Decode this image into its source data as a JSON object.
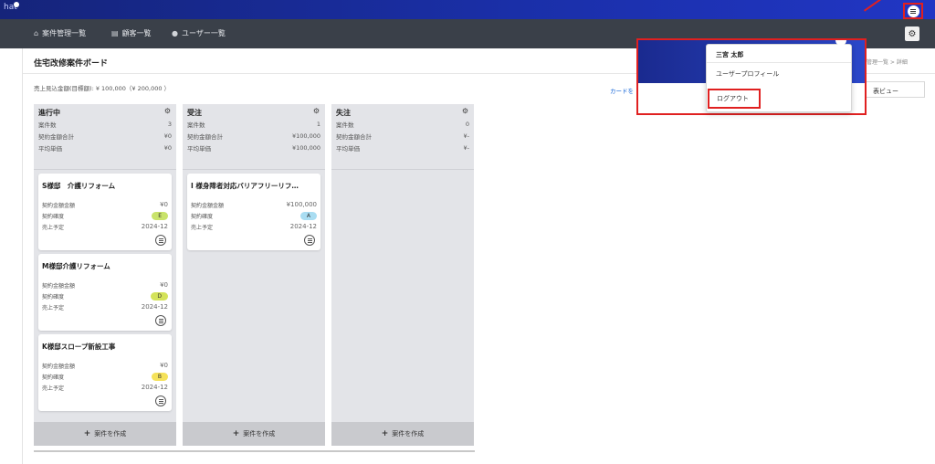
{
  "header": {
    "logo": "hat"
  },
  "nav": {
    "items": [
      {
        "label": "案件管理一覧",
        "icon": "home-icon"
      },
      {
        "label": "顧客一覧",
        "icon": "list-icon"
      },
      {
        "label": "ユーザー一覧",
        "icon": "user-icon"
      }
    ]
  },
  "page": {
    "title": "住宅改修案件ボード",
    "breadcrumb": "件管理一覧 > 詳細",
    "sales_summary": "売上見込金額(目標額): ¥ 100,000（¥ 200,000 ）",
    "card_link": "カードを",
    "view_button": "表ビュー"
  },
  "columns": [
    {
      "title": "進行中",
      "stats": [
        {
          "label": "案件数",
          "value": "3"
        },
        {
          "label": "契約金額合計",
          "value": "¥0"
        },
        {
          "label": "平均単価",
          "value": "¥0"
        }
      ],
      "cards": [
        {
          "title": "S様邸　介護リフォーム",
          "amount_label": "契約金額金額",
          "amount": "¥0",
          "certainty_label": "契約確度",
          "certainty": "E",
          "sales_label": "売上予定",
          "sales_date": "2024-12"
        },
        {
          "title": "M様邸介護リフォーム",
          "amount_label": "契約金額金額",
          "amount": "¥0",
          "certainty_label": "契約確度",
          "certainty": "D",
          "sales_label": "売上予定",
          "sales_date": "2024-12"
        },
        {
          "title": "K様邸スロープ新設工事",
          "amount_label": "契約金額金額",
          "amount": "¥0",
          "certainty_label": "契約確度",
          "certainty": "B",
          "sales_label": "売上予定",
          "sales_date": "2024-12"
        }
      ],
      "create_label": "案件を作成"
    },
    {
      "title": "受注",
      "stats": [
        {
          "label": "案件数",
          "value": "1"
        },
        {
          "label": "契約金額合計",
          "value": "¥100,000"
        },
        {
          "label": "平均単価",
          "value": "¥100,000"
        }
      ],
      "cards": [
        {
          "title": "I 様身障者対応バリアフリーリフ…",
          "amount_label": "契約金額金額",
          "amount": "¥100,000",
          "certainty_label": "契約確度",
          "certainty": "A",
          "sales_label": "売上予定",
          "sales_date": "2024-12"
        }
      ],
      "create_label": "案件を作成"
    },
    {
      "title": "失注",
      "stats": [
        {
          "label": "案件数",
          "value": "0"
        },
        {
          "label": "契約金額合計",
          "value": "¥-"
        },
        {
          "label": "平均単価",
          "value": "¥-"
        }
      ],
      "cards": [],
      "create_label": "案件を作成"
    }
  ],
  "badge_colors": {
    "E": "#c9e36b",
    "D": "#d4e35a",
    "B": "#f5e25a",
    "A": "#a9ddf2"
  },
  "dropdown": {
    "user_name": "三宮 太郎",
    "profile_label": "ユーザープロフィール",
    "logout_label": "ログアウト"
  }
}
